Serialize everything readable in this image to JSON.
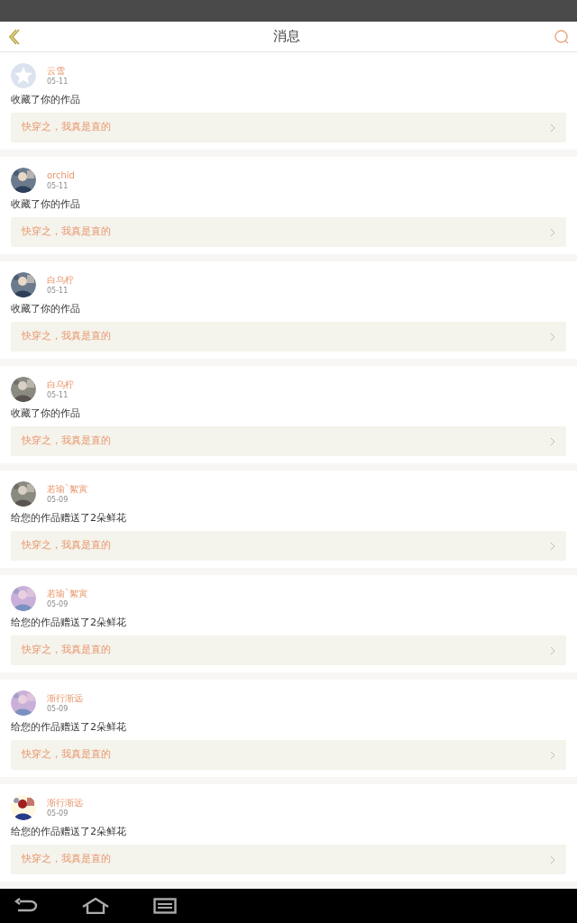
{
  "header": {
    "title": "消息"
  },
  "messages": [
    {
      "avatar": {
        "kind": "default"
      },
      "name": "云雪",
      "date": "05-11",
      "text": "收藏了你的作品",
      "work": "快穿之，我真是直的"
    },
    {
      "name": "orchid",
      "date": "05-11",
      "text": "收藏了你的作品",
      "work": "快穿之，我真是直的"
    },
    {
      "name": "白乌柠",
      "date": "05-11",
      "text": "收藏了你的作品",
      "work": "快穿之，我真是直的"
    },
    {
      "name": "白乌柠",
      "date": "05-11",
      "text": "收藏了你的作品",
      "work": "快穿之，我真是直的"
    },
    {
      "name": "若瑜`絮寅",
      "date": "05-09",
      "text": "给您的作品赠送了2朵鲜花",
      "work": "快穿之，我真是直的"
    },
    {
      "name": "若瑜`絮寅",
      "date": "05-09",
      "text": "给您的作品赠送了2朵鲜花",
      "work": "快穿之，我真是直的"
    },
    {
      "name": "渐行渐远",
      "date": "05-09",
      "text": "给您的作品赠送了2朵鲜花",
      "work": "快穿之，我真是直的"
    },
    {
      "name": "渐行渐远",
      "date": "05-09",
      "text": "给您的作品赠送了2朵鲜花",
      "work": "快穿之，我真是直的"
    }
  ]
}
